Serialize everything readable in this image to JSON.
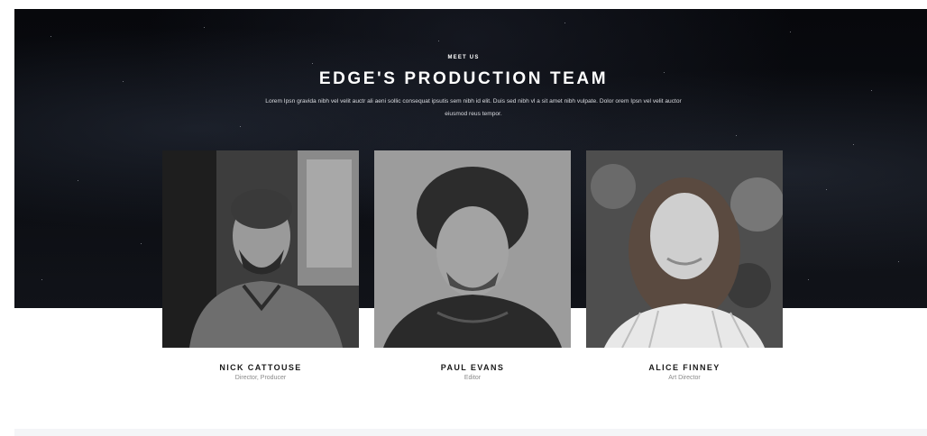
{
  "section": {
    "eyebrow": "MEET US",
    "title": "EDGE'S PRODUCTION TEAM",
    "description": "Lorem Ipsn gravida nibh vel velit auctr ali aeni sollic consequat ipsutis sem nibh id elit. Duis sed nibh vl a sit amet nibh vulpate. Dolor orem Ipsn vel velit auctor eiusmod reus tempor."
  },
  "team": [
    {
      "name": "NICK CATTOUSE",
      "role": "Director, Producer"
    },
    {
      "name": "PAUL EVANS",
      "role": "Editor"
    },
    {
      "name": "ALICE FINNEY",
      "role": "Art Director"
    }
  ]
}
